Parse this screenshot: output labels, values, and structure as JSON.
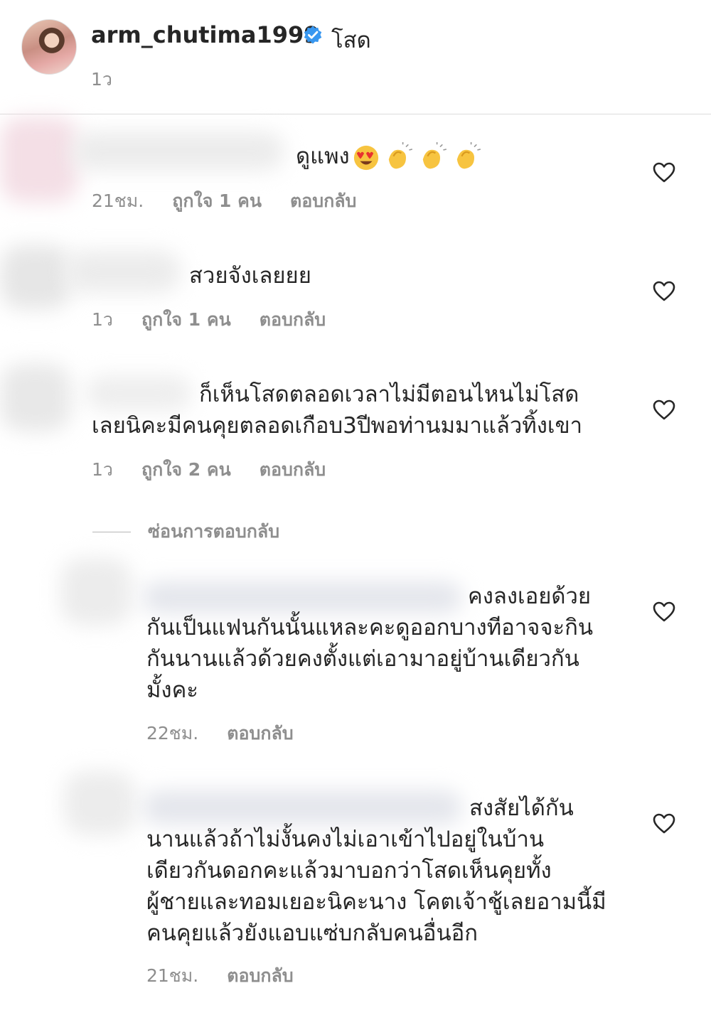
{
  "post": {
    "username": "arm_chutima1999",
    "caption": "โสด",
    "time": "1ว"
  },
  "comments": [
    {
      "text": "ดูแพง",
      "emojis": [
        "heart-eyes-emoji",
        "clapping-hands-emoji",
        "clapping-hands-emoji",
        "clapping-hands-emoji"
      ],
      "time": "21ชม.",
      "likes": "ถูกใจ 1 คน",
      "reply": "ตอบกลับ"
    },
    {
      "text": "สวยจังเลยยย",
      "time": "1ว",
      "likes": "ถูกใจ 1 คน",
      "reply": "ตอบกลับ"
    },
    {
      "text_line1": "ก็เห็นโสดตลอดเวลาไม่มีตอนไหนไม่โสด",
      "text_line2": "เลยนิคะมีคนคุยตลอดเกือบ3ปีพอท่านมมาแล้วทิ้งเขา",
      "time": "1ว",
      "likes": "ถูกใจ 2 คน",
      "reply": "ตอบกลับ"
    }
  ],
  "hide_replies": "ซ่อนการตอบกลับ",
  "replies": [
    {
      "lines": [
        "คงลงเอยด้วย",
        "กันเป็นแฟนกันนั้นแหละคะดูออกบางทีอาจจะกิน",
        "กันนานแล้วด้วยคงตั้งแต่เอามาอยู่บ้านเดียวกัน",
        "มั้งคะ"
      ],
      "time": "22ชม.",
      "reply": "ตอบกลับ"
    },
    {
      "lines": [
        "สงสัยได้กัน",
        "นานแล้วถ้าไม่งั้นคงไม่เอาเข้าไปอยู่ในบ้าน",
        "เดียวกันดอกคะแล้วมาบอกว่าโสดเห็นคุยทั้ง",
        "ผู้ชายและทอมเยอะนิคะนาง โคตเจ้าชู้เลยอามนี้มี",
        "คนคุยแล้วยังแอบแซ่บกลับคนอื่นอีก"
      ],
      "time": "21ชม.",
      "reply": "ตอบกลับ"
    }
  ],
  "colors": {
    "text": "#262626",
    "secondary": "#8e8e8e",
    "verified": "#3897f0",
    "divider": "#dbdbdb"
  }
}
